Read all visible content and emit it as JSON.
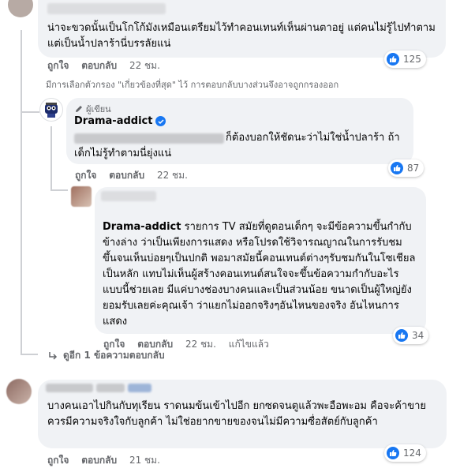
{
  "comments": [
    {
      "text": "น่าจะขวดนั้นเป็นโกโก้มังเหมือนเตรียมไว้ทำคอนเทนท์เห็นผ่านตาอยู่ แต่คนไม่รู้ไปทำตามแต่เป็นน้ำปลาร้านี่บรรลัยแน่",
      "actions": {
        "like": "ถูกใจ",
        "reply": "ตอบกลับ",
        "time": "22 ชม."
      },
      "reactions": "125"
    },
    {
      "text": "บางคนเอาไปกินกับทุเรียน ราดนมข้นเข้าไปอีก ยกซดจนตูแล้วพะอือพะอม คือจะค้าขายควรมีความจริงใจกับลูกค้า ไม่ใช่อยากขายของจนไม่มีความซื่อสัตย์กับลูกค้า",
      "actions": {
        "like": "ถูกใจ",
        "reply": "ตอบกลับ",
        "time": "21 ชม."
      },
      "reactions": "124"
    }
  ],
  "filter_notice": "มีการเลือกตัวกรอง \"เกี่ยวข้องที่สุด\" ไว้ การตอบกลับบางส่วนจึงอาจถูกกรองออก",
  "author_reply": {
    "badge": "ผู้เขียน",
    "name": "Drama-addict",
    "text": "ก็ต้องบอกให้ชัดนะว่าไม่ใช่น้ำปลาร้า ถ้าเด็กไม่รู้ทำตามนี่ยุ่งแน่",
    "actions": {
      "like": "ถูกใจ",
      "reply": "ตอบกลับ",
      "time": "22 ชม."
    },
    "reactions": "87"
  },
  "nested_reply": {
    "mention": "Drama-addict",
    "text": " รายการ TV สมัยที่ดูตอนเด็กๆ จะมีข้อความขึ้นกำกับข้างล่าง ว่าเป็นเพียงการแสดง หรือโปรดใช้วิจารณญาณในการรับชม ขึ้นจนเห็นบ่อยๆเป็นปกติ พอมาสมัยนี้คอนเทนต์ต่างๆรับชมกันในโซเชียลเป็นหลัก แทบไม่เห็นผู้สร้างคอนเทนต์สนใจจะขึ้นข้อความกำกับอะไรแบบนี้ช่วยเลย มีแค่บางช่องบางคนและเป็นส่วนน้อย ขนาดเป็นผู้ใหญ่ยังยอมรับเลยค่ะคุณเจ้า ว่าแยกไม่ออกจริงๆอันไหนของจริง อันไหนการแสดง",
    "actions": {
      "like": "ถูกใจ",
      "reply": "ตอบกลับ",
      "time": "22 ชม.",
      "edited": "แก้ไขแล้ว"
    },
    "reactions": "34"
  },
  "more_replies": "ดูอีก 1 ข้อความตอบกลับ",
  "colors": {
    "bubble": "#f0f2f5",
    "meta": "#65676b",
    "like_blue": "#1877f2"
  }
}
